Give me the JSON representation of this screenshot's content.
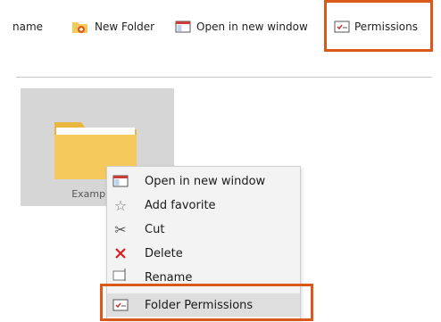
{
  "toolbar": {
    "rename_label": "name",
    "new_folder_label": "New Folder",
    "open_new_window_label": "Open in new window",
    "permissions_label": "Permissions"
  },
  "tile": {
    "label": "Example F"
  },
  "context_menu": {
    "items": [
      {
        "label": "Open in new window",
        "icon": "window-icon"
      },
      {
        "label": "Add favorite",
        "icon": "star-icon"
      },
      {
        "label": "Cut",
        "icon": "scissors-icon"
      },
      {
        "label": "Delete",
        "icon": "delete-x-icon"
      },
      {
        "label": "Rename",
        "icon": "rename-icon"
      },
      {
        "label": "Folder Permissions",
        "icon": "permissions-icon"
      }
    ]
  },
  "colors": {
    "highlight": "#d9581a",
    "folder": "#f5c95c",
    "delete_red": "#d42020",
    "new_folder_badge": "#e05a1b"
  }
}
